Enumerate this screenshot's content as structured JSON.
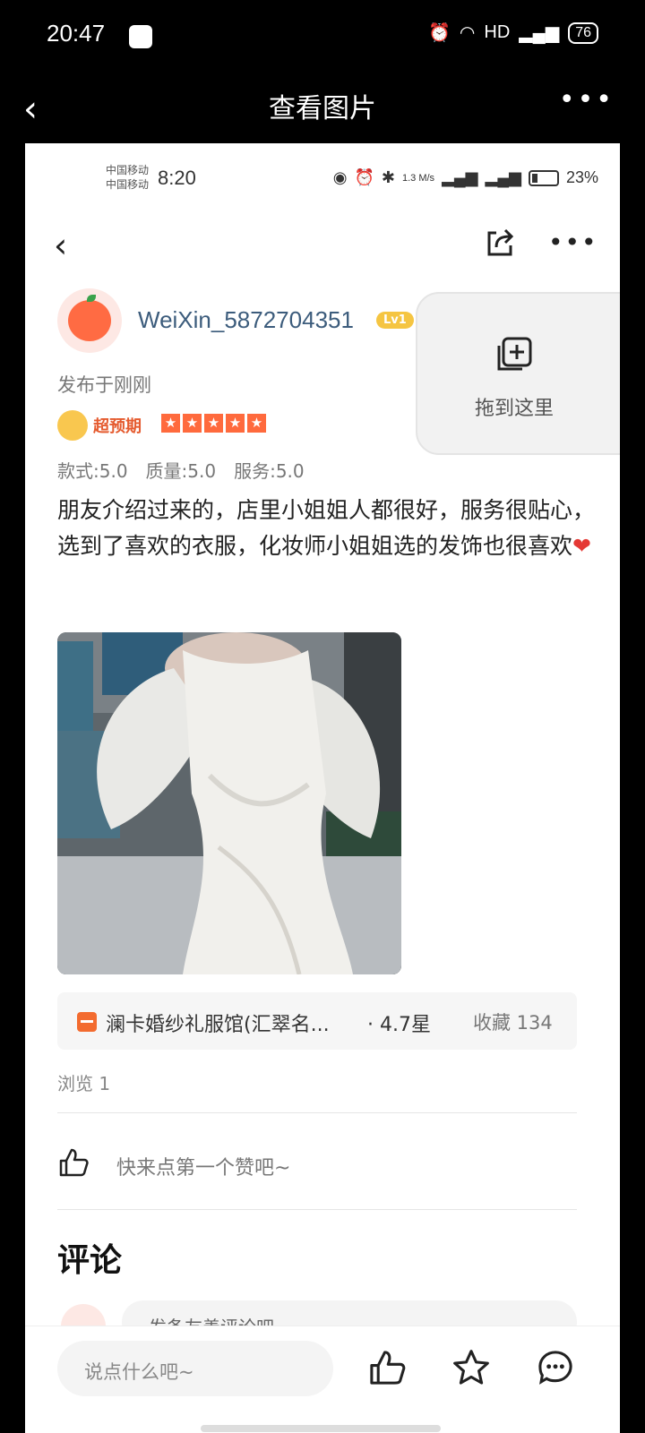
{
  "outer_status": {
    "time": "20:47",
    "network": "HD",
    "signal": "4G",
    "battery": "76"
  },
  "outer_header": {
    "back_icon": "back-icon",
    "title": "查看图片",
    "more_icon": "more-icon"
  },
  "inner_status": {
    "carrier1": "中国移动",
    "carrier2": "中国移动",
    "time": "8:20",
    "speed": "1.3 M/s",
    "battery_percent": "23%"
  },
  "inner_header": {
    "back_icon": "back-icon",
    "share_icon": "share-icon",
    "more_icon": "more-icon"
  },
  "user": {
    "name": "WeiXin_5872704351",
    "level": "Lv1"
  },
  "drag_overlay": {
    "label": "拖到这里"
  },
  "post": {
    "time": "发布于刚刚",
    "badge_text": "超预期",
    "stars": 5,
    "scores": {
      "style": "款式:5.0",
      "quality": "质量:5.0",
      "service": "服务:5.0"
    },
    "text": "朋友介绍过来的，店里小姐姐人都很好，服务很贴心，选到了喜欢的衣服，化妆师小姐姐选的发饰也很喜欢",
    "emoji": "❤"
  },
  "shop": {
    "name": "澜卡婚纱礼服馆(汇翠名...",
    "rating": "· 4.7星",
    "favorites": "收藏 134"
  },
  "views": "浏览 1",
  "like_prompt": "快来点第一个赞吧~",
  "comments": {
    "title": "评论",
    "prompt": "发条友善评论吧~"
  },
  "bottom_bar": {
    "input_placeholder": "说点什么吧~"
  },
  "colors": {
    "accent": "#ff6a3d",
    "username": "#3c5c7c",
    "badge": "#f5c542"
  }
}
